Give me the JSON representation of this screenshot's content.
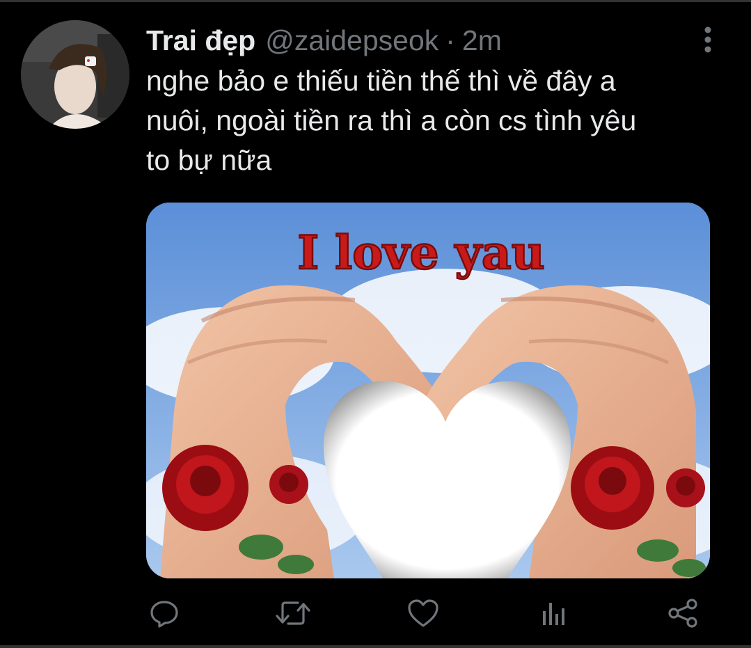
{
  "tweet": {
    "display_name": "Trai đẹp",
    "handle": "@zaidepseok",
    "separator": "·",
    "time": "2m",
    "text_lines": [
      "nghe bảo e thiếu tiền thế thì về đây a",
      "nuôi, ngoài tiền ra thì a còn cs tình yêu",
      "to bự nữa"
    ],
    "media": {
      "overlay_text": "I love yau"
    }
  },
  "icons": {
    "more": "more-vertical-icon",
    "reply": "reply-icon",
    "retweet": "retweet-icon",
    "like": "heart-icon",
    "analytics": "analytics-icon",
    "share": "share-icon"
  },
  "colors": {
    "background": "#000000",
    "text": "#e7e9ea",
    "secondary": "#71767b",
    "divider": "#2f3336"
  }
}
